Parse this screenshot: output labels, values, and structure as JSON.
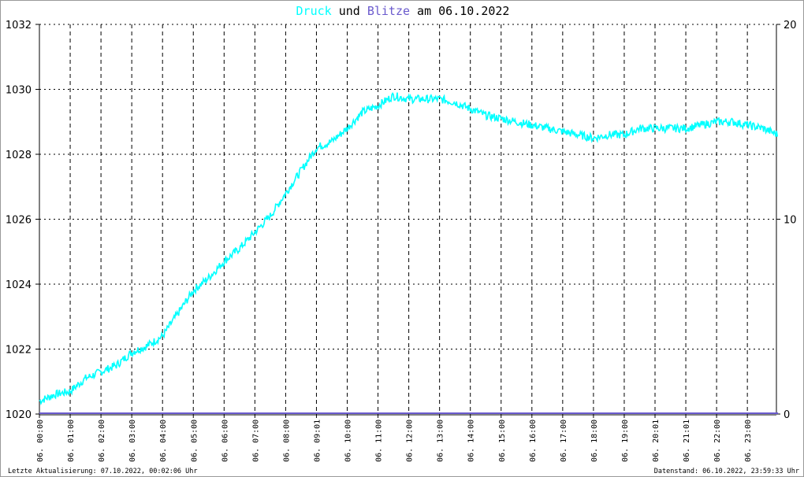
{
  "title": {
    "part1": "Druck",
    "part2": " und ",
    "part3": "Blitze",
    "part4": " am 06.10.2022"
  },
  "footer": {
    "left": "Letzte Aktualisierung: 07.10.2022, 00:02:06 Uhr",
    "right": "Datenstand: 06.10.2022, 23:59:33 Uhr"
  },
  "colors": {
    "pressure": "#00ffff",
    "lightning": "#6a5acd",
    "grid": "#000000"
  },
  "chart_data": {
    "type": "line",
    "title": "Druck und Blitze am 06.10.2022",
    "xlabel": "",
    "ylabel": "",
    "y2label": "",
    "ylim": [
      1020,
      1032
    ],
    "y2lim": [
      0,
      20
    ],
    "yticks": [
      "1020",
      "1022",
      "1024",
      "1026",
      "1028",
      "1030",
      "1032"
    ],
    "y2ticks": [
      "0",
      "10",
      "20"
    ],
    "xticks": [
      "06. 00:00",
      "06. 01:00",
      "06. 02:00",
      "06. 03:00",
      "06. 04:00",
      "06. 05:00",
      "06. 06:00",
      "06. 07:00",
      "06. 08:00",
      "06. 09:01",
      "06. 10:00",
      "06. 11:00",
      "06. 12:00",
      "06. 13:00",
      "06. 14:00",
      "06. 15:00",
      "06. 16:00",
      "06. 17:00",
      "06. 18:00",
      "06. 19:00",
      "06. 20:01",
      "06. 21:01",
      "06. 22:00",
      "06. 23:00"
    ],
    "grid": true,
    "x_hours": [
      0,
      0.5,
      1,
      1.5,
      2,
      2.5,
      3,
      3.5,
      4,
      4.5,
      5,
      5.5,
      6,
      6.5,
      7,
      7.5,
      8,
      8.5,
      9,
      9.5,
      10,
      10.5,
      11,
      11.5,
      12,
      12.5,
      13,
      13.5,
      14,
      14.5,
      15,
      15.5,
      16,
      16.5,
      17,
      17.5,
      18,
      18.5,
      19,
      19.5,
      20,
      20.5,
      21,
      21.5,
      22,
      22.5,
      23,
      23.5,
      24
    ],
    "series": [
      {
        "name": "Druck",
        "axis": "left",
        "values": [
          1020.4,
          1020.6,
          1020.7,
          1021.1,
          1021.3,
          1021.5,
          1021.9,
          1022.1,
          1022.4,
          1023.1,
          1023.8,
          1024.2,
          1024.7,
          1025.1,
          1025.6,
          1026.1,
          1026.8,
          1027.5,
          1028.2,
          1028.4,
          1028.8,
          1029.3,
          1029.5,
          1029.8,
          1029.7,
          1029.7,
          1029.7,
          1029.6,
          1029.4,
          1029.2,
          1029.1,
          1029.0,
          1028.9,
          1028.8,
          1028.7,
          1028.6,
          1028.5,
          1028.6,
          1028.6,
          1028.8,
          1028.8,
          1028.8,
          1028.8,
          1028.9,
          1029.0,
          1029.0,
          1028.9,
          1028.8,
          1028.6
        ]
      },
      {
        "name": "Blitze",
        "axis": "right",
        "values": [
          0,
          0,
          0,
          0,
          0,
          0,
          0,
          0,
          0,
          0,
          0,
          0,
          0,
          0,
          0,
          0,
          0,
          0,
          0,
          0,
          0,
          0,
          0,
          0,
          0,
          0,
          0,
          0,
          0,
          0,
          0,
          0,
          0,
          0,
          0,
          0,
          0,
          0,
          0,
          0,
          0,
          0,
          0,
          0,
          0,
          0,
          0,
          0,
          0
        ]
      }
    ]
  }
}
